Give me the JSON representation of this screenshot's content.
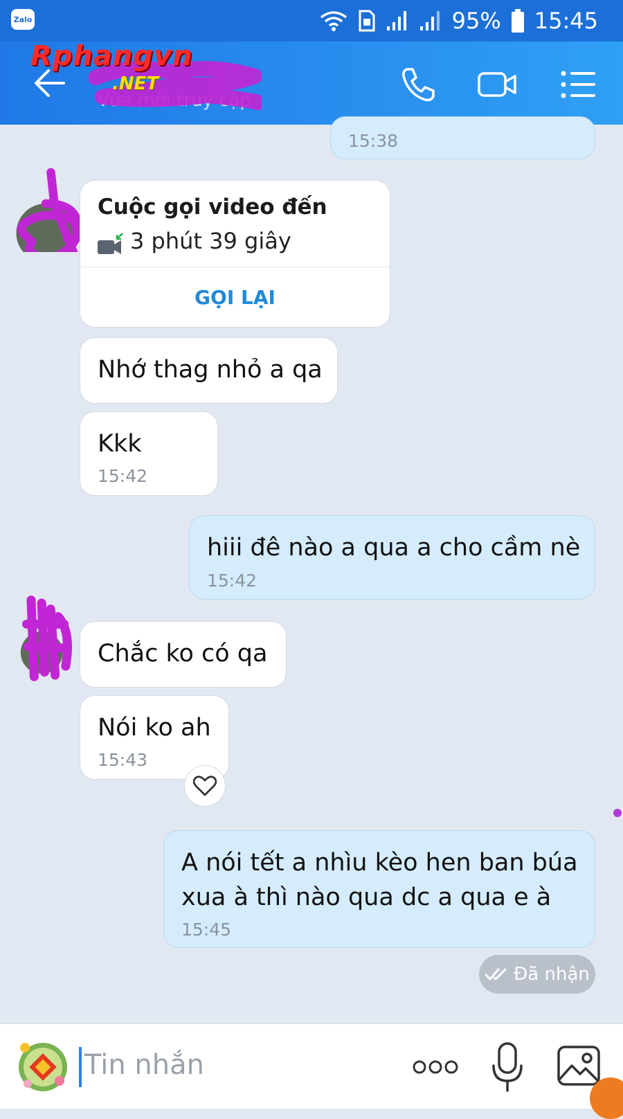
{
  "status_bar": {
    "app_badge": "Zalo",
    "battery": "95%",
    "time": "15:45"
  },
  "header": {
    "subtitle": "Vừa mới truy cập",
    "watermark_line1": "Rphangvn",
    "watermark_line2": ".NET",
    "icons": [
      "back-icon",
      "phone-icon",
      "video-call-icon",
      "menu-icon"
    ]
  },
  "messages": [
    {
      "side": "out",
      "time": "15:38"
    },
    {
      "side": "in",
      "type": "call",
      "title": "Cuộc gọi video đến",
      "duration": "3 phút 39 giây",
      "action": "GỌI LẠI"
    },
    {
      "side": "in",
      "text": "Nhớ thag nhỏ a qa"
    },
    {
      "side": "in",
      "text": "Kkk",
      "time": "15:42"
    },
    {
      "side": "out",
      "text": "hiii đê nào a qua a cho cầm nè",
      "time": "15:42"
    },
    {
      "side": "in",
      "text": "Chắc ko có qa"
    },
    {
      "side": "in",
      "text": "Nói ko ah",
      "time": "15:43"
    },
    {
      "side": "out",
      "lines": [
        "A nói tết a nhìu kèo hen ban búa",
        "xua à thì nào qua dc a qua e à"
      ],
      "time": "15:45"
    }
  ],
  "read_status": "Đã nhận",
  "input": {
    "placeholder": "Tin nhắn"
  },
  "colors": {
    "header": "#1f78e6",
    "bubble_out": "#d5ecfd",
    "bubble_in": "#ffffff",
    "chat_bg": "#e2e8f1",
    "accent": "#1f8ad8"
  }
}
